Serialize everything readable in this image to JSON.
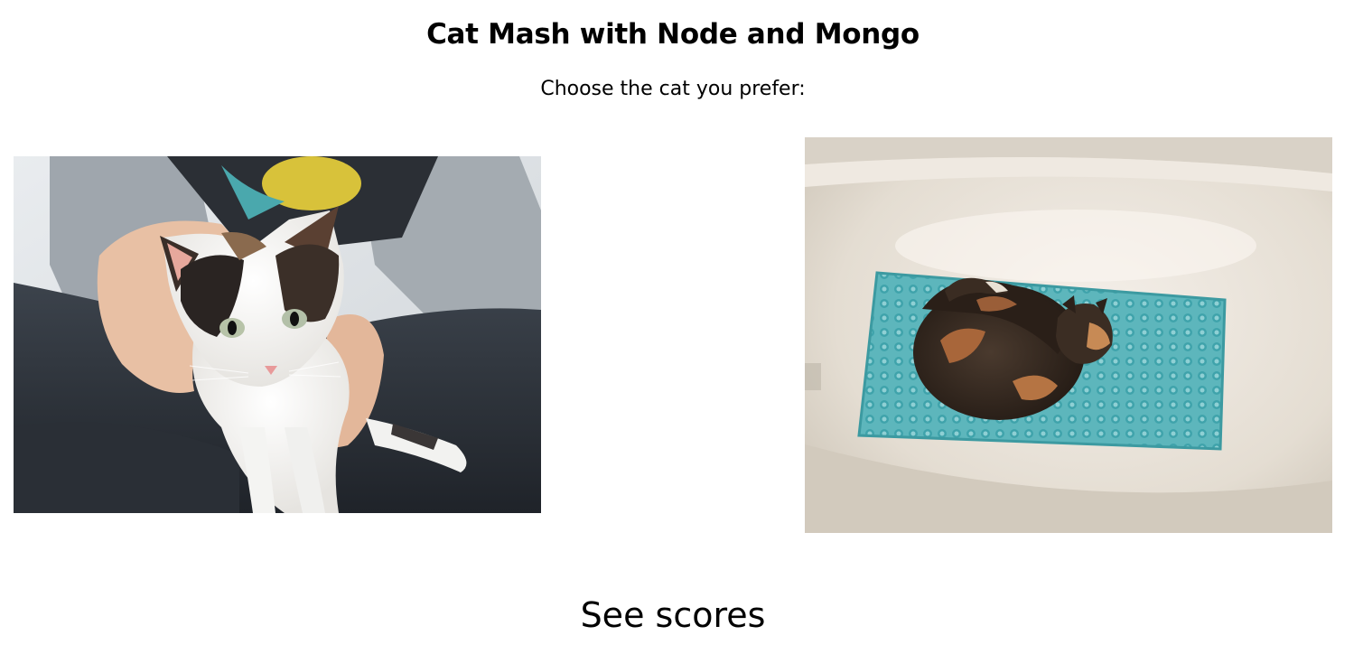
{
  "header": {
    "title": "Cat Mash with Node and Mongo",
    "subtitle": "Choose the cat you prefer:"
  },
  "cats": [
    {
      "name": "calico-kitten-held",
      "description_icon": "cat-photo"
    },
    {
      "name": "calico-cat-in-bathtub",
      "description_icon": "cat-photo"
    }
  ],
  "footer": {
    "scores_link": "See scores"
  }
}
